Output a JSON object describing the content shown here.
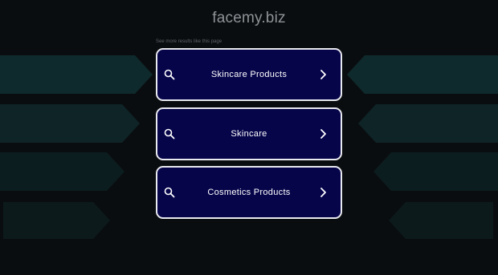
{
  "header": {
    "site_name": "facemy.biz"
  },
  "results": {
    "hint": "See more results like this page",
    "items": [
      {
        "label": "Skincare Products",
        "icon": "search-icon",
        "action_icon": "chevron-right-icon"
      },
      {
        "label": "Skincare",
        "icon": "search-icon",
        "action_icon": "chevron-right-icon"
      },
      {
        "label": "Cosmetics Products",
        "icon": "search-icon",
        "action_icon": "chevron-right-icon"
      }
    ]
  },
  "colors": {
    "background": "#0a0d10",
    "button_fill": "#06054a",
    "button_border": "#e9e9f0",
    "title_text": "#8e9296",
    "decor_teal": "#0f2b2e"
  }
}
